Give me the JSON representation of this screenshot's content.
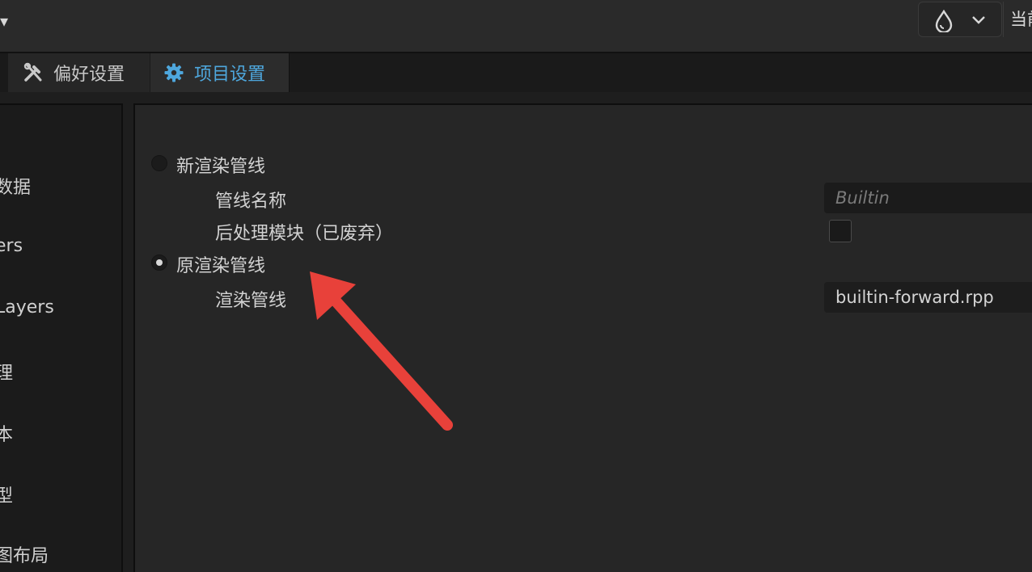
{
  "topbar": {
    "left_glyph": "▾",
    "dropdown_icon": "drop-icon",
    "cut_label": "当前"
  },
  "tabs": [
    {
      "label": "偏好设置",
      "icon": "tools-icon",
      "active": false
    },
    {
      "label": "项目设置",
      "icon": "gear-icon",
      "active": true
    }
  ],
  "sidebar": {
    "items": [
      "数据",
      "ers",
      "Layers",
      "理",
      "本",
      "型",
      "图布局"
    ]
  },
  "render_pipeline": {
    "new_pipeline_label": "新渲染管线",
    "pipeline_name_label": "管线名称",
    "pipeline_name_placeholder": "Builtin",
    "post_process_label": "后处理模块（已废弃）",
    "legacy_pipeline_label": "原渲染管线",
    "render_pipeline_label": "渲染管线",
    "render_pipeline_value": "builtin-forward.rpp",
    "selected": "legacy"
  },
  "colors": {
    "accent": "#4ea7dd",
    "annotation_arrow": "#e8413a"
  }
}
